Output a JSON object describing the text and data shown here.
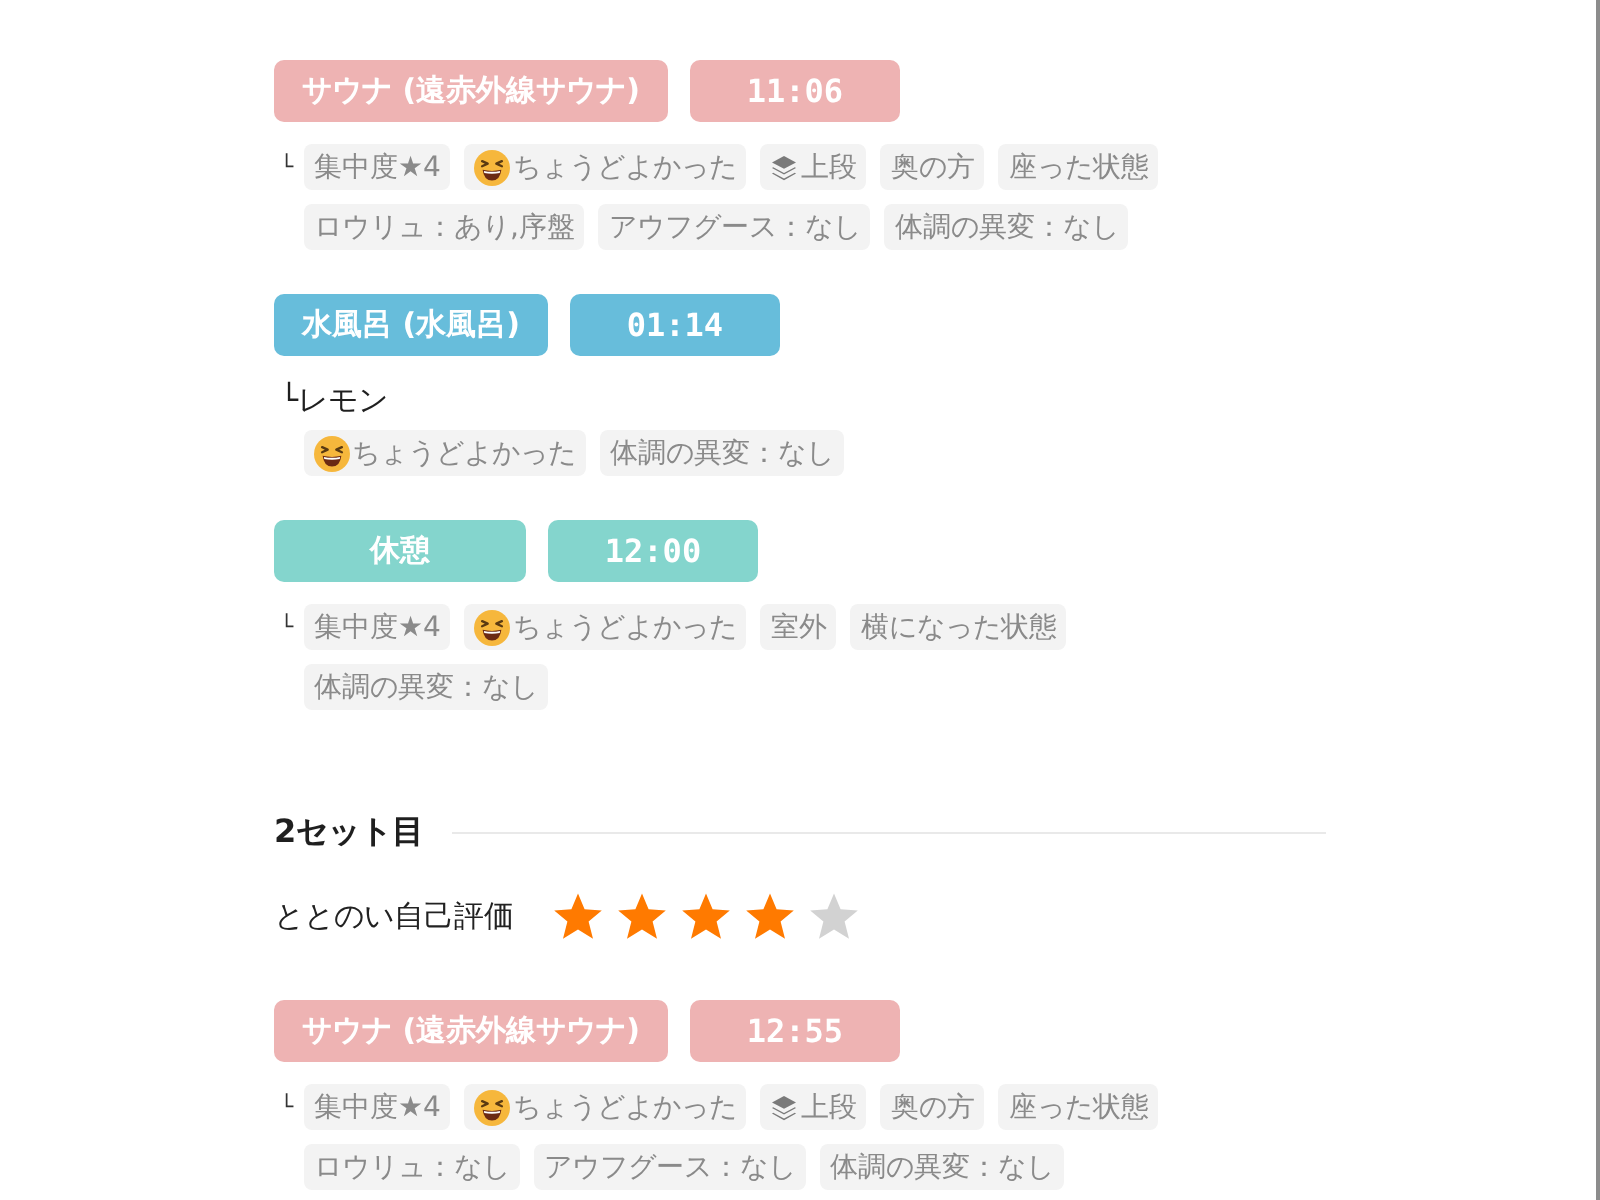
{
  "sets": [
    {
      "steps": [
        {
          "kind": "sauna",
          "label": "サウナ (遠赤外線サウナ)",
          "time": "11:06",
          "marker": "└",
          "tags": [
            {
              "kind": "plain",
              "text": "集中度★4"
            },
            {
              "kind": "mood",
              "text": "ちょうどよかった"
            },
            {
              "kind": "tier",
              "text": "上段"
            },
            {
              "kind": "plain",
              "text": "奥の方"
            },
            {
              "kind": "plain",
              "text": "座った状態"
            },
            {
              "kind": "plain",
              "text": "ロウリュ：あり,序盤"
            },
            {
              "kind": "plain",
              "text": "アウフグース：なし"
            },
            {
              "kind": "plain",
              "text": "体調の異変：なし"
            }
          ]
        },
        {
          "kind": "water",
          "label": "水風呂 (水風呂)",
          "time": "01:14",
          "marker": "└",
          "note": "レモン",
          "tags": [
            {
              "kind": "mood",
              "text": "ちょうどよかった"
            },
            {
              "kind": "plain",
              "text": "体調の異変：なし"
            }
          ]
        },
        {
          "kind": "rest",
          "label": "休憩",
          "time": "12:00",
          "marker": "└",
          "tags": [
            {
              "kind": "plain",
              "text": "集中度★4"
            },
            {
              "kind": "mood",
              "text": "ちょうどよかった"
            },
            {
              "kind": "plain",
              "text": "室外"
            },
            {
              "kind": "plain",
              "text": "横になった状態"
            },
            {
              "kind": "plain",
              "text": "体調の異変：なし"
            }
          ]
        }
      ]
    },
    {
      "title": "2セット目",
      "rating_label": "ととのい自己評価",
      "stars": 4,
      "steps": [
        {
          "kind": "sauna",
          "label": "サウナ (遠赤外線サウナ)",
          "time": "12:55",
          "marker": "└",
          "tags": [
            {
              "kind": "plain",
              "text": "集中度★4"
            },
            {
              "kind": "mood",
              "text": "ちょうどよかった"
            },
            {
              "kind": "tier",
              "text": "上段"
            },
            {
              "kind": "plain",
              "text": "奥の方"
            },
            {
              "kind": "plain",
              "text": "座った状態"
            },
            {
              "kind": "plain",
              "text": "ロウリュ：なし"
            },
            {
              "kind": "plain",
              "text": "アウフグース：なし"
            },
            {
              "kind": "plain",
              "text": "体調の異変：なし"
            }
          ]
        }
      ]
    }
  ]
}
